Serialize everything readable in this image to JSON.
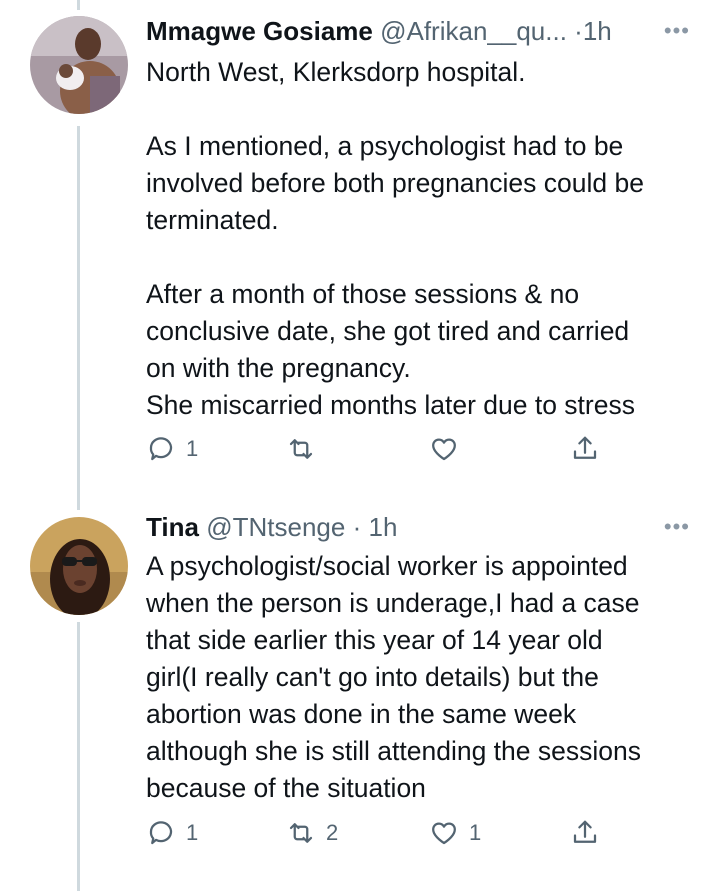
{
  "colors": {
    "thread_line": "#cfd9de",
    "muted": "#536471",
    "text": "#0f1419"
  },
  "tweets": [
    {
      "display_name": "Mmagwe Gosiame",
      "handle": "@Afrikan__qu...",
      "separator": "·",
      "time": "1h",
      "more": "•••",
      "avatar": "profile-photo",
      "paragraphs": [
        [
          "North West, Klerksdorp hospital."
        ],
        [
          "As I mentioned, a psychologist had to be",
          "involved before both pregnancies could be",
          "terminated."
        ],
        [
          "After a month of those sessions & no",
          "conclusive date, she got tired and carried",
          "on with the pregnancy.",
          "She miscarried months later due to stress"
        ]
      ],
      "actions": {
        "reply_count": "1",
        "retweet_count": "",
        "like_count": ""
      }
    },
    {
      "display_name": "Tina",
      "handle": "@TNtsenge",
      "separator": "·",
      "time": "1h",
      "more": "•••",
      "avatar": "profile-photo",
      "paragraphs": [
        [
          "A psychologist/social worker is appointed",
          "when the person is underage,I had a case",
          "that side earlier this year of 14 year old",
          "girl(I really can't go into details) but the",
          "abortion was done in the same week",
          "although she is still attending the sessions",
          "because of the situation"
        ]
      ],
      "actions": {
        "reply_count": "1",
        "retweet_count": "2",
        "like_count": "1"
      }
    }
  ]
}
